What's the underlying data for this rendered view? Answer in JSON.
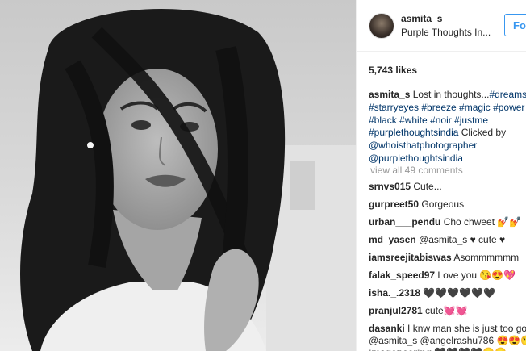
{
  "post": {
    "username": "asmita_s",
    "location": "Purple Thoughts In...",
    "follow_label": "Fo",
    "likes": "5,743 likes",
    "caption_user": "asmita_s",
    "caption_text": " Lost in thoughts...",
    "caption_tags": "#dreams #starryeyes #breeze #magic #power #black #white #noir #justme #purplethoughtsindia",
    "caption_mid": " Clicked by ",
    "caption_tail": "@whoisthatphotographer @purplethoughtsindia",
    "view_all": "view all 49 comments"
  },
  "comments": [
    {
      "user": "srnvs015",
      "text": " Cute..."
    },
    {
      "user": "gurpreet50",
      "text": " Gorgeous"
    },
    {
      "user": "urban___pendu",
      "text": " Cho chweet 💅💅"
    },
    {
      "user": "md_yasen",
      "text": " @asmita_s ♥ cute ♥"
    },
    {
      "user": "iamsreejitabiswas",
      "text": " Asommmmmm"
    },
    {
      "user": "falak_speed97",
      "text": " Love you 😘😍💖"
    },
    {
      "user": "isha._.2318",
      "text": " 🖤🖤🖤🖤🖤🖤"
    },
    {
      "user": "pranjul2781",
      "text": " cute💓💓"
    },
    {
      "user": "dasanki",
      "text": " I knw man she is just too goo @asmita_s @angelrashu786 😍😍😘✌"
    },
    {
      "user": "imageneering",
      "text": " 🖤🖤🖤🖤😶😶"
    }
  ]
}
